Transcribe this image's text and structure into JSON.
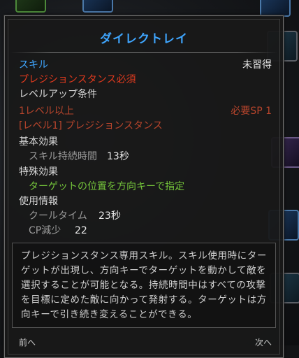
{
  "tooltip": {
    "title": "ダイレクトレイ",
    "skill_label": "スキル",
    "status": "未習得",
    "prerequisite": "プレジションスタンス必須",
    "levelup_heading": "レベルアップ条件",
    "level_requirement": "1レベル以上",
    "sp_requirement": "必要SP 1",
    "skill_requirement": "[レベル1] プレジションスタンス",
    "basic_effect_heading": "基本効果",
    "duration_label": "スキル持続時間",
    "duration_value": "13秒",
    "special_effect_heading": "特殊効果",
    "special_effect": "ターゲットの位置を方向キーで指定",
    "usage_heading": "使用情報",
    "cooldown_label": "クールタイム",
    "cooldown_value": "23秒",
    "cp_label": "CP減少",
    "cp_value": "22",
    "description": "プレジションスタンス専用スキル。スキル使用時にターゲットが出現し、方向キーでターゲットを動かして敵を選択することが可能となる。持続時間中はすべての攻撃を目標に定めた敵に向かって発射する。ターゲットは方向キーで引き続き変えることができる。",
    "prev_label": "前へ",
    "next_label": "次へ"
  },
  "colors": {
    "title": "#3fa6ff",
    "requirement_red": "#e03a1e",
    "effect_green": "#74c43a",
    "text_white": "#d8d8d8",
    "text_grey": "#9a9a9a"
  }
}
